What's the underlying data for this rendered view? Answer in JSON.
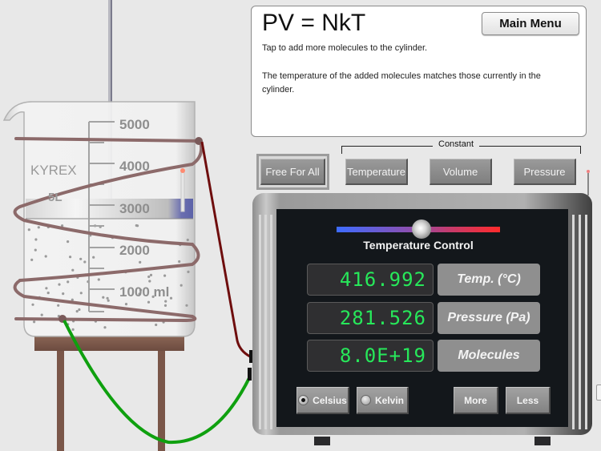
{
  "info": {
    "formula": "PV = NkT",
    "main_menu_label": "Main Menu",
    "line1": "Tap to add more molecules to the cylinder.",
    "line2": "The temperature of the added molecules matches those currently in the cylinder."
  },
  "modes": {
    "constant_label": "Constant",
    "selected": "Free For All",
    "buttons": [
      "Free For All",
      "Temperature",
      "Volume",
      "Pressure"
    ]
  },
  "beaker": {
    "brand": "KYREX",
    "capacity": "5L",
    "scale_labels": [
      "5000",
      "4000",
      "3000",
      "2000",
      "1000 ml"
    ],
    "piston_level_ml": 3000
  },
  "device": {
    "slider": {
      "label": "Temperature Control",
      "position_fraction": 0.52,
      "gradient": [
        "#3d6cff",
        "#ff2b2b"
      ]
    },
    "readouts": [
      {
        "value": "416.992",
        "label": "Temp. (°C)"
      },
      {
        "value": "281.526",
        "label": "Pressure (Pa)"
      },
      {
        "value": "8.0E+19",
        "label": "Molecules"
      }
    ],
    "units": {
      "celsius_label": "Celsius",
      "kelvin_label": "Kelvin",
      "selected": "Celsius"
    },
    "more_label": "More",
    "less_label": "Less",
    "display_color": "#27e85a"
  }
}
